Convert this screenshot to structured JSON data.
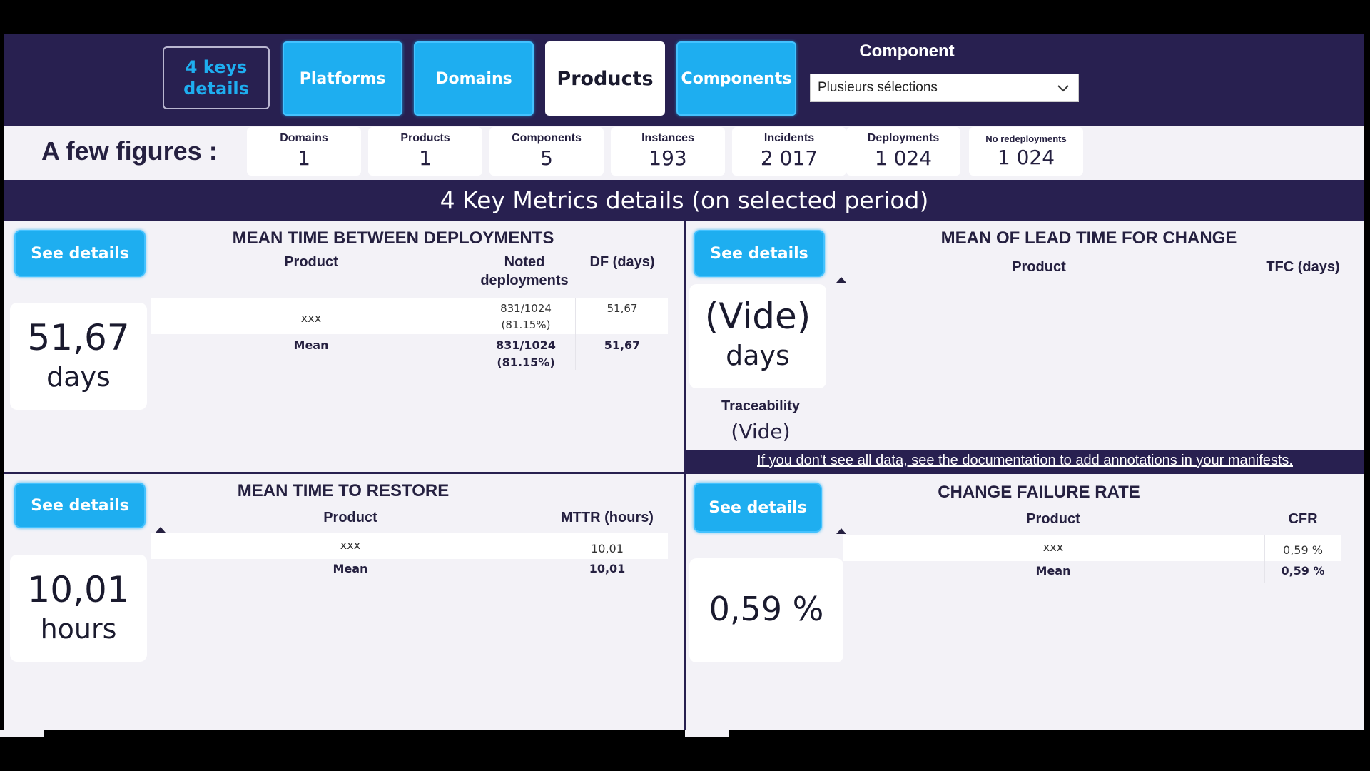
{
  "nav": {
    "keys_details": "4 keys details",
    "platforms": "Platforms",
    "domains": "Domains",
    "products": "Products",
    "components": "Components"
  },
  "component_filter": {
    "label": "Component",
    "selected": "Plusieurs sélections"
  },
  "figures": {
    "title": "A few figures :",
    "cards": [
      {
        "label": "Domains",
        "value": "1"
      },
      {
        "label": "Products",
        "value": "1"
      },
      {
        "label": "Components",
        "value": "5"
      },
      {
        "label": "Instances",
        "value": "193"
      },
      {
        "label": "Incidents",
        "value": "2 017"
      },
      {
        "label": "Deployments",
        "value": "1 024"
      },
      {
        "label": "No redeployments",
        "value": "1 024"
      }
    ]
  },
  "banner": "4 Key Metrics details (on selected period)",
  "see_details": "See details",
  "mtbd": {
    "title": "MEAN TIME BETWEEN DEPLOYMENTS",
    "kpi_value": "51,67",
    "kpi_unit": "days",
    "columns": [
      "Product",
      "Noted deployments",
      "DF (days)"
    ],
    "row": {
      "product": "xxx",
      "noted": "831/1024 (81.15%)",
      "df": "51,67"
    },
    "mean": {
      "label": "Mean",
      "noted": "831/1024 (81.15%)",
      "df": "51,67"
    }
  },
  "lead_time": {
    "title": "MEAN OF LEAD TIME FOR CHANGE",
    "kpi_value": "(Vide)",
    "kpi_unit": "days",
    "columns": [
      "Product",
      "TFC (days)"
    ],
    "traceability_label": "Traceability",
    "traceability_value": "(Vide)",
    "warning": "If you don't see all data, see the documentation to add annotations in your manifests."
  },
  "mttr": {
    "title": "MEAN TIME TO RESTORE",
    "kpi_value": "10,01",
    "kpi_unit": "hours",
    "columns": [
      "Product",
      "MTTR (hours)"
    ],
    "row": {
      "product": "xxx",
      "value": "10,01"
    },
    "mean": {
      "label": "Mean",
      "value": "10,01"
    }
  },
  "cfr": {
    "title": "CHANGE FAILURE RATE",
    "kpi_value": "0,59 %",
    "columns": [
      "Product",
      "CFR"
    ],
    "row": {
      "product": "xxx",
      "value": "0,59 %"
    },
    "mean": {
      "label": "Mean",
      "value": "0,59 %"
    }
  },
  "colors": {
    "navy": "#282050",
    "accent_blue": "#1eaef0",
    "canvas": "#f3f2f7"
  }
}
